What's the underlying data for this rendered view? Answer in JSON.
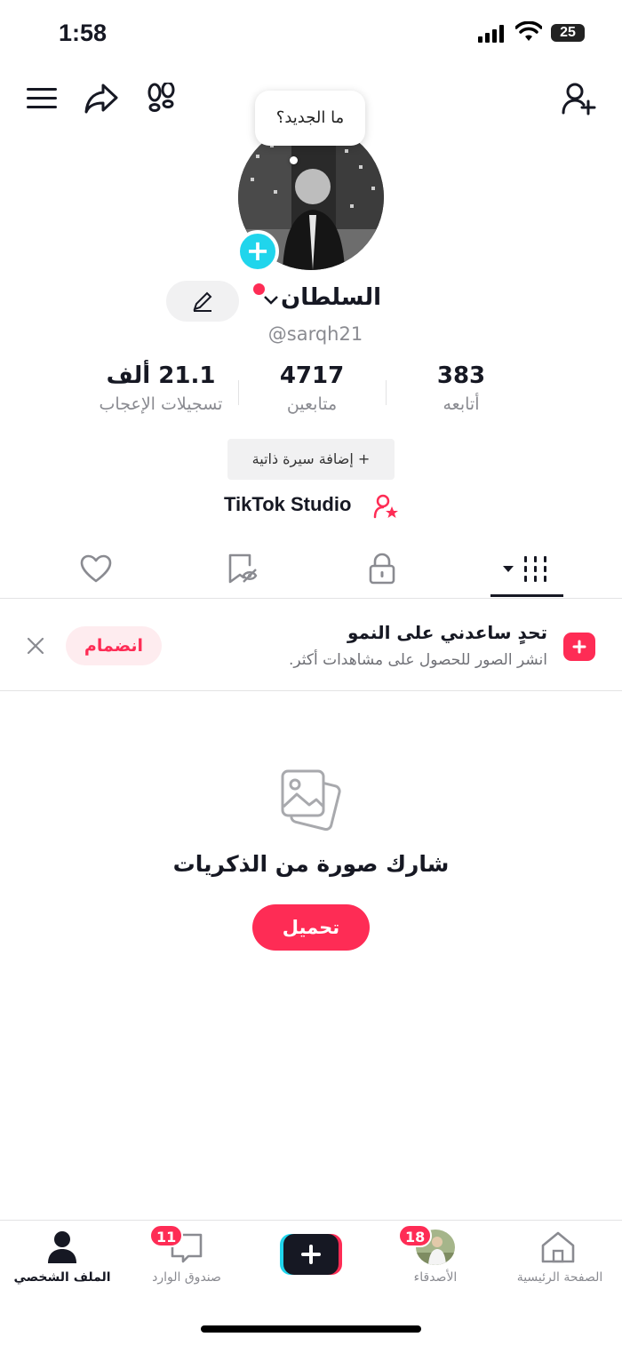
{
  "status_bar": {
    "time": "1:58",
    "battery": "25"
  },
  "header": {
    "bubble_text": "ما الجديد؟"
  },
  "profile": {
    "name": "السلطان",
    "handle": "@sarqh21",
    "stats": [
      {
        "value": "383",
        "label": "أتابعه"
      },
      {
        "value": "4717",
        "label": "متابعين"
      },
      {
        "value": "21.1 ألف",
        "label": "تسجيلات الإعجاب"
      }
    ],
    "bio_button": "+ إضافة سيرة ذاتية",
    "studio": "TikTok Studio"
  },
  "challenge": {
    "title": "تحدٍ ساعدني على النمو",
    "subtitle": "انشر الصور للحصول على مشاهدات أكثر.",
    "join": "انضمام"
  },
  "empty_state": {
    "title": "شارك صورة من الذكريات",
    "upload": "تحميل"
  },
  "bottom_nav": {
    "home": "الصفحة الرئيسية",
    "friends": "الأصدقاء",
    "friends_badge": "18",
    "inbox": "صندوق الوارد",
    "inbox_badge": "11",
    "profile": "الملف الشخصي"
  },
  "colors": {
    "accent": "#fe2c55",
    "cyan": "#20d5ec",
    "text": "#161823",
    "muted": "#8a8b91"
  }
}
